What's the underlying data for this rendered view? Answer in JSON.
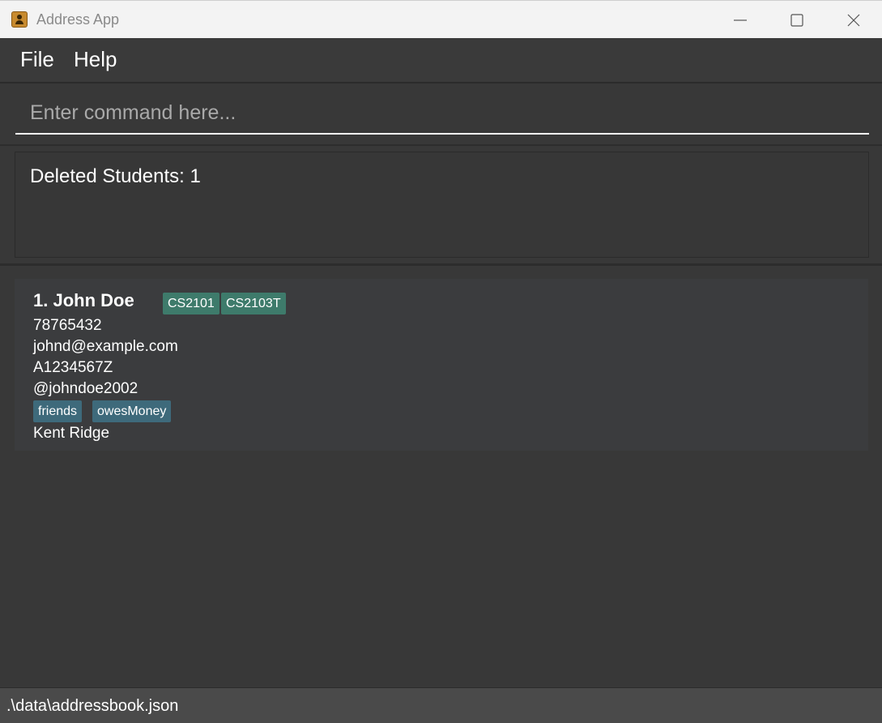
{
  "window": {
    "title": "Address App",
    "app_icon": "address-book-icon"
  },
  "menu": {
    "file_label": "File",
    "help_label": "Help"
  },
  "command": {
    "placeholder": "Enter command here...",
    "value": ""
  },
  "result": {
    "text": "Deleted Students: 1"
  },
  "persons": [
    {
      "index_name": "1. John Doe",
      "modules": [
        "CS2101",
        "CS2103T"
      ],
      "phone": "78765432",
      "email": "johnd@example.com",
      "matric": "A1234567Z",
      "telegram": "@johndoe2002",
      "tags": [
        "friends",
        "owesMoney"
      ],
      "address": "Kent Ridge"
    }
  ],
  "status": {
    "file_path": ".\\data\\addressbook.json"
  },
  "colors": {
    "background": "#383838",
    "module_tag": "#3e7b6b",
    "label_tag": "#3e6a7b",
    "status_bar": "#4a4a4a"
  }
}
